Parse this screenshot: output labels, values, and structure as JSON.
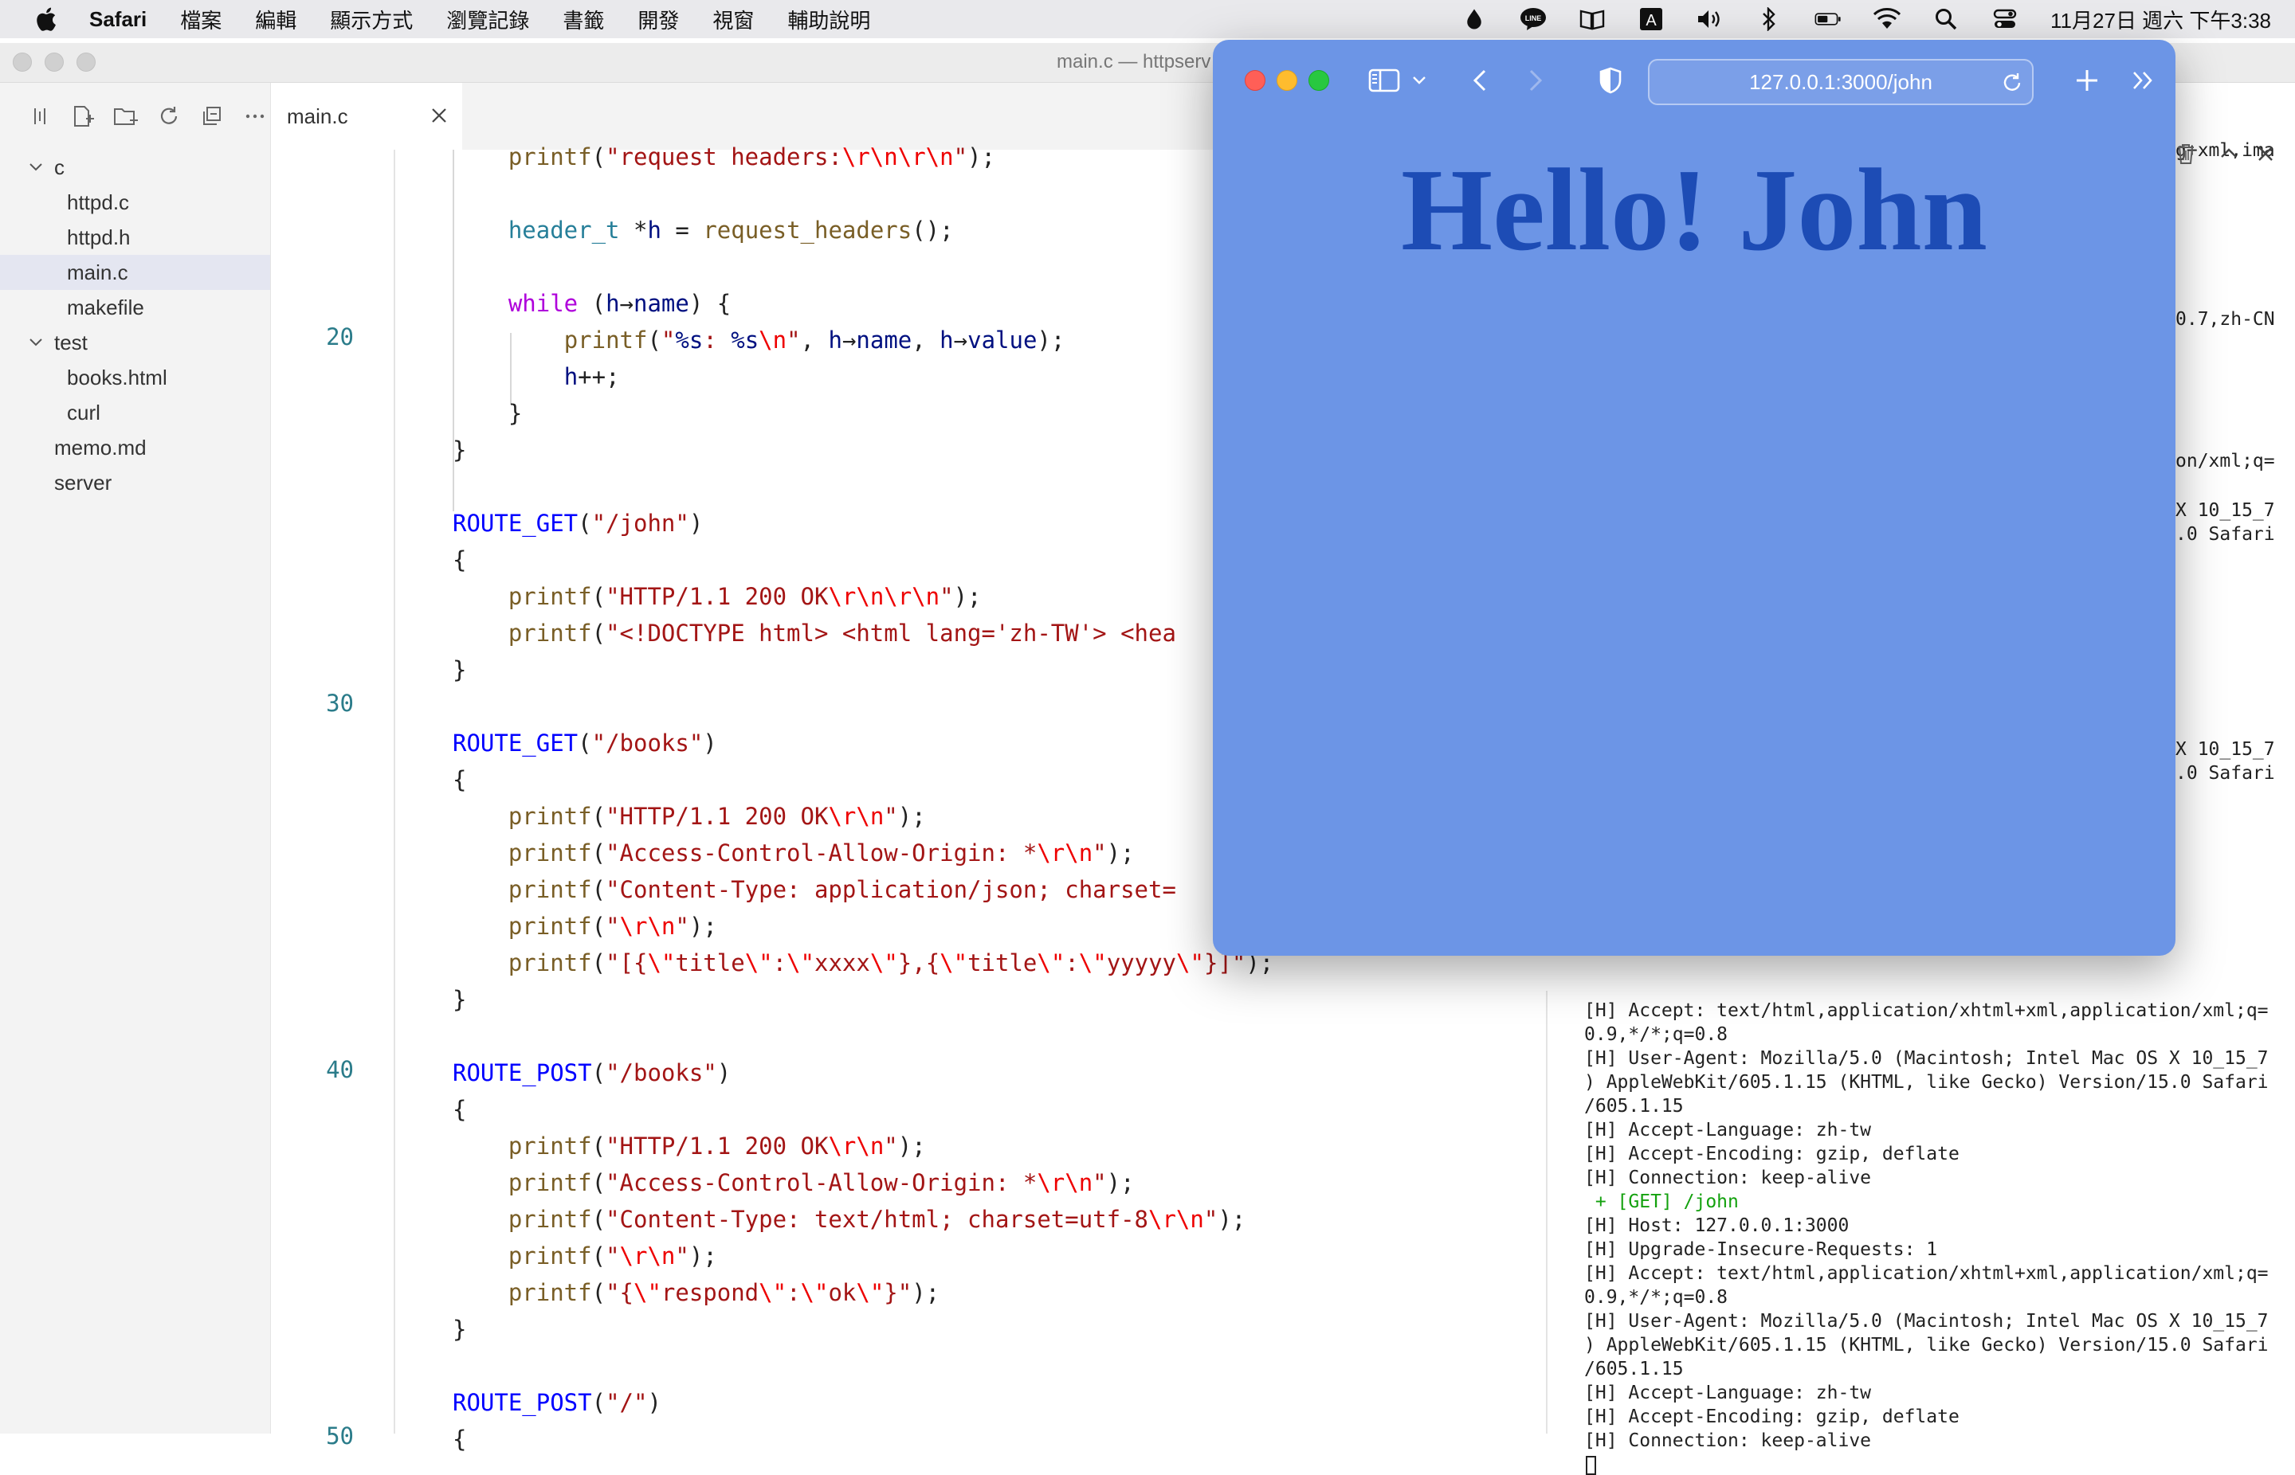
{
  "menubar": {
    "app": "Safari",
    "items": [
      "檔案",
      "編輯",
      "顯示方式",
      "瀏覽記錄",
      "書籤",
      "開發",
      "視窗",
      "輔助說明"
    ],
    "tray_icons": [
      "drop-icon",
      "line-icon",
      "book-icon",
      "input-method-icon",
      "volume-icon",
      "bluetooth-icon",
      "battery-icon",
      "wifi-icon",
      "spotlight-search-icon",
      "control-center-icon"
    ],
    "input_method_label": "A",
    "line_label": "LINE",
    "clock": "11月27日 週六 下午3:38"
  },
  "editor": {
    "window_title": "main.c — httpserv",
    "tab": {
      "label": "main.c"
    },
    "tree": [
      {
        "label": "c",
        "type": "folder",
        "expanded": true,
        "depth": 0
      },
      {
        "label": "httpd.c",
        "type": "file",
        "depth": 1
      },
      {
        "label": "httpd.h",
        "type": "file",
        "depth": 1
      },
      {
        "label": "main.c",
        "type": "file",
        "depth": 1,
        "selected": true
      },
      {
        "label": "makefile",
        "type": "file",
        "depth": 1
      },
      {
        "label": "test",
        "type": "folder",
        "expanded": true,
        "depth": 0
      },
      {
        "label": "books.html",
        "type": "file",
        "depth": 1
      },
      {
        "label": "curl",
        "type": "file",
        "depth": 1
      },
      {
        "label": "memo.md",
        "type": "file",
        "depth": 0
      },
      {
        "label": "server",
        "type": "file",
        "depth": 0
      }
    ],
    "line_numbers": [
      "20",
      "30",
      "40",
      "50"
    ],
    "code": [
      [
        {
          "t": "    "
        },
        {
          "t": "printf",
          "c": "call"
        },
        {
          "t": "("
        },
        {
          "t": "\"request headers:",
          "c": "str"
        },
        {
          "t": "\\r\\n\\r\\n",
          "c": "esc"
        },
        {
          "t": "\"",
          "c": "str"
        },
        {
          "t": ");"
        }
      ],
      [],
      [
        {
          "t": "    "
        },
        {
          "t": "header_t",
          "c": "type"
        },
        {
          "t": " *"
        },
        {
          "t": "h",
          "c": "var"
        },
        {
          "t": " = "
        },
        {
          "t": "request_headers",
          "c": "call"
        },
        {
          "t": "();"
        }
      ],
      [],
      [
        {
          "t": "    "
        },
        {
          "t": "while",
          "c": "kw"
        },
        {
          "t": " ("
        },
        {
          "t": "h",
          "c": "var"
        },
        {
          "t": "→"
        },
        {
          "t": "name",
          "c": "var"
        },
        {
          "t": ") {"
        }
      ],
      [
        {
          "t": "        "
        },
        {
          "t": "printf",
          "c": "call"
        },
        {
          "t": "("
        },
        {
          "t": "\"",
          "c": "str"
        },
        {
          "t": "%s",
          "c": "var"
        },
        {
          "t": ": ",
          "c": "str"
        },
        {
          "t": "%s",
          "c": "var"
        },
        {
          "t": "\\n",
          "c": "esc"
        },
        {
          "t": "\"",
          "c": "str"
        },
        {
          "t": ", "
        },
        {
          "t": "h",
          "c": "var"
        },
        {
          "t": "→"
        },
        {
          "t": "name",
          "c": "var"
        },
        {
          "t": ", "
        },
        {
          "t": "h",
          "c": "var"
        },
        {
          "t": "→"
        },
        {
          "t": "value",
          "c": "var"
        },
        {
          "t": ");"
        }
      ],
      [
        {
          "t": "        "
        },
        {
          "t": "h",
          "c": "var"
        },
        {
          "t": "++;"
        }
      ],
      [
        {
          "t": "    }"
        }
      ],
      [
        {
          "t": "}"
        }
      ],
      [],
      [
        {
          "t": "ROUTE_GET",
          "c": "macro"
        },
        {
          "t": "("
        },
        {
          "t": "\"/john\"",
          "c": "str"
        },
        {
          "t": ")"
        }
      ],
      [
        {
          "t": "{"
        }
      ],
      [
        {
          "t": "    "
        },
        {
          "t": "printf",
          "c": "call"
        },
        {
          "t": "("
        },
        {
          "t": "\"HTTP/1.1 200 OK",
          "c": "str"
        },
        {
          "t": "\\r\\n\\r\\n",
          "c": "esc"
        },
        {
          "t": "\"",
          "c": "str"
        },
        {
          "t": ");"
        }
      ],
      [
        {
          "t": "    "
        },
        {
          "t": "printf",
          "c": "call"
        },
        {
          "t": "("
        },
        {
          "t": "\"<!DOCTYPE html> <html lang='zh-TW'> <hea",
          "c": "str"
        }
      ],
      [
        {
          "t": "}"
        }
      ],
      [],
      [
        {
          "t": "ROUTE_GET",
          "c": "macro"
        },
        {
          "t": "("
        },
        {
          "t": "\"/books\"",
          "c": "str"
        },
        {
          "t": ")"
        }
      ],
      [
        {
          "t": "{"
        }
      ],
      [
        {
          "t": "    "
        },
        {
          "t": "printf",
          "c": "call"
        },
        {
          "t": "("
        },
        {
          "t": "\"HTTP/1.1 200 OK",
          "c": "str"
        },
        {
          "t": "\\r\\n",
          "c": "esc"
        },
        {
          "t": "\"",
          "c": "str"
        },
        {
          "t": ");"
        }
      ],
      [
        {
          "t": "    "
        },
        {
          "t": "printf",
          "c": "call"
        },
        {
          "t": "("
        },
        {
          "t": "\"Access-Control-Allow-Origin: *",
          "c": "str"
        },
        {
          "t": "\\r\\n",
          "c": "esc"
        },
        {
          "t": "\"",
          "c": "str"
        },
        {
          "t": ");"
        }
      ],
      [
        {
          "t": "    "
        },
        {
          "t": "printf",
          "c": "call"
        },
        {
          "t": "("
        },
        {
          "t": "\"Content-Type: application/json; charset=",
          "c": "str"
        }
      ],
      [
        {
          "t": "    "
        },
        {
          "t": "printf",
          "c": "call"
        },
        {
          "t": "("
        },
        {
          "t": "\"",
          "c": "str"
        },
        {
          "t": "\\r\\n",
          "c": "esc"
        },
        {
          "t": "\"",
          "c": "str"
        },
        {
          "t": ");"
        }
      ],
      [
        {
          "t": "    "
        },
        {
          "t": "printf",
          "c": "call"
        },
        {
          "t": "("
        },
        {
          "t": "\"[{",
          "c": "str"
        },
        {
          "t": "\\\"",
          "c": "esc"
        },
        {
          "t": "title",
          "c": "str"
        },
        {
          "t": "\\\"",
          "c": "esc"
        },
        {
          "t": ":",
          "c": "str"
        },
        {
          "t": "\\\"",
          "c": "esc"
        },
        {
          "t": "xxxx",
          "c": "str"
        },
        {
          "t": "\\\"",
          "c": "esc"
        },
        {
          "t": "},{",
          "c": "str"
        },
        {
          "t": "\\\"",
          "c": "esc"
        },
        {
          "t": "title",
          "c": "str"
        },
        {
          "t": "\\\"",
          "c": "esc"
        },
        {
          "t": ":",
          "c": "str"
        },
        {
          "t": "\\\"",
          "c": "esc"
        },
        {
          "t": "yyyyy",
          "c": "str"
        },
        {
          "t": "\\\"",
          "c": "esc"
        },
        {
          "t": "}]\"",
          "c": "str"
        },
        {
          "t": ");"
        }
      ],
      [
        {
          "t": "}"
        }
      ],
      [],
      [
        {
          "t": "ROUTE_POST",
          "c": "macro"
        },
        {
          "t": "("
        },
        {
          "t": "\"/books\"",
          "c": "str"
        },
        {
          "t": ")"
        }
      ],
      [
        {
          "t": "{"
        }
      ],
      [
        {
          "t": "    "
        },
        {
          "t": "printf",
          "c": "call"
        },
        {
          "t": "("
        },
        {
          "t": "\"HTTP/1.1 200 OK",
          "c": "str"
        },
        {
          "t": "\\r\\n",
          "c": "esc"
        },
        {
          "t": "\"",
          "c": "str"
        },
        {
          "t": ");"
        }
      ],
      [
        {
          "t": "    "
        },
        {
          "t": "printf",
          "c": "call"
        },
        {
          "t": "("
        },
        {
          "t": "\"Access-Control-Allow-Origin: *",
          "c": "str"
        },
        {
          "t": "\\r\\n",
          "c": "esc"
        },
        {
          "t": "\"",
          "c": "str"
        },
        {
          "t": ");"
        }
      ],
      [
        {
          "t": "    "
        },
        {
          "t": "printf",
          "c": "call"
        },
        {
          "t": "("
        },
        {
          "t": "\"Content-Type: text/html; charset=utf-8",
          "c": "str"
        },
        {
          "t": "\\r\\n",
          "c": "esc"
        },
        {
          "t": "\"",
          "c": "str"
        },
        {
          "t": ");"
        }
      ],
      [
        {
          "t": "    "
        },
        {
          "t": "printf",
          "c": "call"
        },
        {
          "t": "("
        },
        {
          "t": "\"",
          "c": "str"
        },
        {
          "t": "\\r\\n",
          "c": "esc"
        },
        {
          "t": "\"",
          "c": "str"
        },
        {
          "t": ");"
        }
      ],
      [
        {
          "t": "    "
        },
        {
          "t": "printf",
          "c": "call"
        },
        {
          "t": "("
        },
        {
          "t": "\"{",
          "c": "str"
        },
        {
          "t": "\\\"",
          "c": "esc"
        },
        {
          "t": "respond",
          "c": "str"
        },
        {
          "t": "\\\"",
          "c": "esc"
        },
        {
          "t": ":",
          "c": "str"
        },
        {
          "t": "\\\"",
          "c": "esc"
        },
        {
          "t": "ok",
          "c": "str"
        },
        {
          "t": "\\\"",
          "c": "esc"
        },
        {
          "t": "}\"",
          "c": "str"
        },
        {
          "t": ");"
        }
      ],
      [
        {
          "t": "}"
        }
      ],
      [],
      [
        {
          "t": "ROUTE_POST",
          "c": "macro"
        },
        {
          "t": "("
        },
        {
          "t": "\"/\"",
          "c": "str"
        },
        {
          "t": ")"
        }
      ],
      [
        {
          "t": "{"
        }
      ]
    ],
    "terminal_fragments": [
      "g+xml,ima",
      "0.7,zh-CN",
      "on/xml;q=",
      "X 10_15_7",
      ".0 Safari",
      "X 10_15_7",
      ".0 Safari"
    ],
    "terminal_lines": [
      {
        "text": "[H] Accept: text/html,application/xhtml+xml,application/xml;q="
      },
      {
        "text": "0.9,*/*;q=0.8"
      },
      {
        "text": "[H] User-Agent: Mozilla/5.0 (Macintosh; Intel Mac OS X 10_15_7"
      },
      {
        "text": ") AppleWebKit/605.1.15 (KHTML, like Gecko) Version/15.0 Safari"
      },
      {
        "text": "/605.1.15"
      },
      {
        "text": "[H] Accept-Language: zh-tw"
      },
      {
        "text": "[H] Accept-Encoding: gzip, deflate"
      },
      {
        "text": "[H] Connection: keep-alive"
      },
      {
        "text": " + [GET] /john",
        "green": true
      },
      {
        "text": "[H] Host: 127.0.0.1:3000"
      },
      {
        "text": "[H] Upgrade-Insecure-Requests: 1"
      },
      {
        "text": "[H] Accept: text/html,application/xhtml+xml,application/xml;q="
      },
      {
        "text": "0.9,*/*;q=0.8"
      },
      {
        "text": "[H] User-Agent: Mozilla/5.0 (Macintosh; Intel Mac OS X 10_15_7"
      },
      {
        "text": ") AppleWebKit/605.1.15 (KHTML, like Gecko) Version/15.0 Safari"
      },
      {
        "text": "/605.1.15"
      },
      {
        "text": "[H] Accept-Language: zh-tw"
      },
      {
        "text": "[H] Accept-Encoding: gzip, deflate"
      },
      {
        "text": "[H] Connection: keep-alive"
      }
    ]
  },
  "safari": {
    "url": "127.0.0.1:3000/john",
    "page_heading": "Hello! John",
    "background": "#6c95e6",
    "heading_color": "#1d4cb5"
  }
}
